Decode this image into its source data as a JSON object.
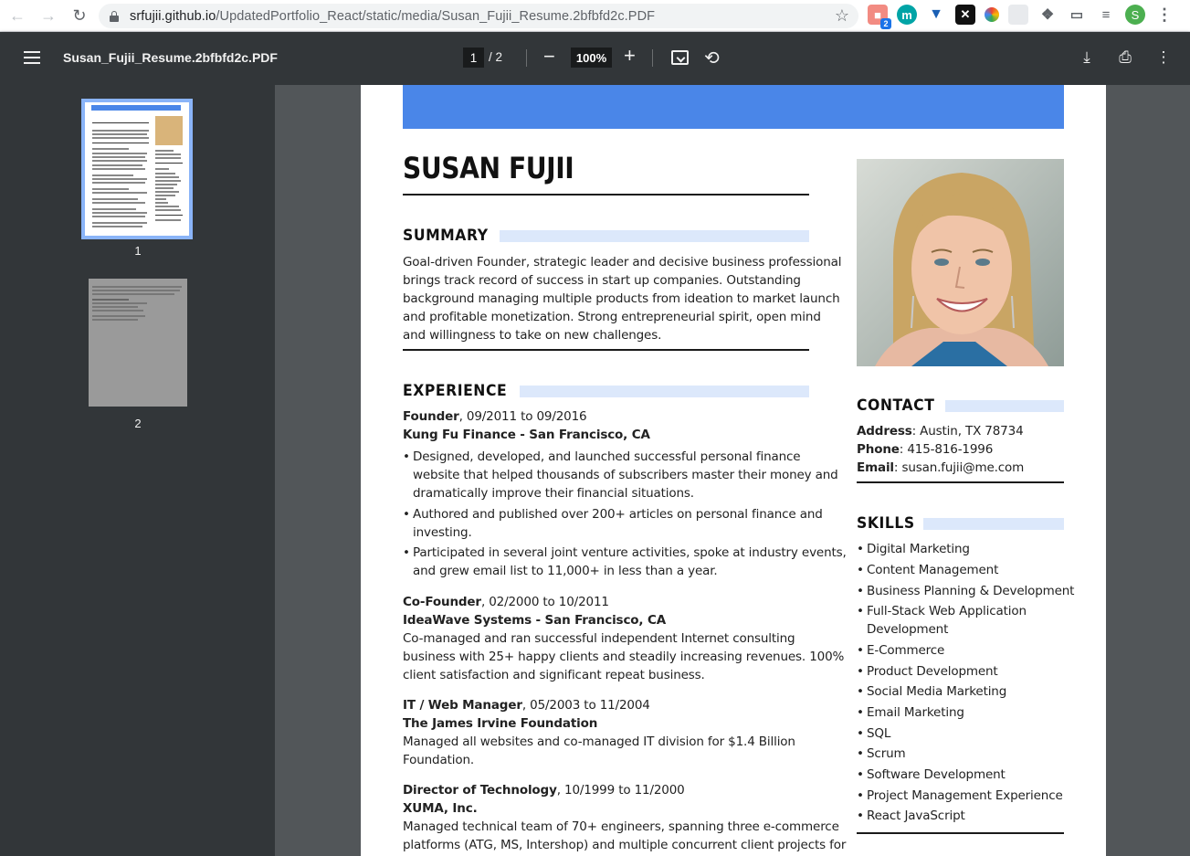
{
  "browser": {
    "url_host": "srfujii.github.io",
    "url_path": "/UpdatedPortfolio_React/static/media/Susan_Fujii_Resume.2bfbfd2c.PDF",
    "ext_badge": "2",
    "profile_initial": "S"
  },
  "pdf_toolbar": {
    "title": "Susan_Fujii_Resume.2bfbfd2c.PDF",
    "current_page": "1",
    "page_total": "/ 2",
    "zoom": "100%",
    "zoom_out": "−",
    "zoom_in": "+"
  },
  "sidebar": {
    "thumbs": [
      {
        "label": "1"
      },
      {
        "label": "2"
      }
    ]
  },
  "resume": {
    "name": "SUSAN FUJII",
    "summary": {
      "title": "SUMMARY",
      "lines": [
        "Goal-driven Founder, strategic leader and decisive business professional",
        "brings track record of success in start up companies. Outstanding",
        "background managing multiple products from ideation to market launch",
        "and profitable monetization. Strong entrepreneurial spirit, open mind",
        "and willingness to take on new challenges."
      ]
    },
    "experience": {
      "title": "EXPERIENCE",
      "jobs": [
        {
          "role": "Founder",
          "dates": ", 09/2011 to 09/2016",
          "company": "Kung Fu Finance - San Francisco, CA",
          "bullets": [
            [
              "Designed, developed, and launched successful personal finance",
              "website that helped thousands of subscribers master their money and",
              "dramatically improve their financial situations."
            ],
            [
              "Authored and published over 200+ articles on personal finance and",
              "investing."
            ],
            [
              "Participated in several joint venture activities, spoke at industry events,",
              "and grew email list to 11,000+ in less than a year."
            ]
          ]
        },
        {
          "role": "Co-Founder",
          "dates": ", 02/2000 to 10/2011",
          "company": "IdeaWave Systems - San Francisco, CA",
          "desc": [
            "Co-managed and ran successful independent Internet consulting",
            "business with 25+ happy clients and steadily increasing revenues. 100%",
            "client satisfaction and significant repeat business."
          ]
        },
        {
          "role": "IT / Web Manager",
          "dates": ", 05/2003 to 11/2004",
          "company": "The James Irvine Foundation",
          "desc": [
            "Managed all websites and co-managed IT division for $1.4 Billion",
            "Foundation."
          ]
        },
        {
          "role": "Director of Technology",
          "dates": ", 10/1999 to 11/2000",
          "company": "XUMA, Inc.",
          "desc": [
            "Managed technical team of 70+ engineers, spanning three e-commerce",
            "platforms (ATG, MS, Intershop) and multiple concurrent client projects for"
          ]
        }
      ]
    },
    "contact": {
      "title": "CONTACT",
      "address_label": "Address",
      "address": ": Austin, TX 78734",
      "phone_label": "Phone",
      "phone": ": 415-816-1996",
      "email_label": "Email",
      "email": ": susan.fujii@me.com"
    },
    "skills": {
      "title": "SKILLS",
      "items": [
        "Digital Marketing",
        "Content Management",
        "Business Planning & Development",
        "Full-Stack Web Application",
        "Development",
        "E-Commerce",
        "Product Development",
        "Social Media Marketing",
        "Email Marketing",
        "SQL",
        "Scrum",
        "Software Development",
        "Project Management Experience",
        "React JavaScript"
      ]
    }
  }
}
